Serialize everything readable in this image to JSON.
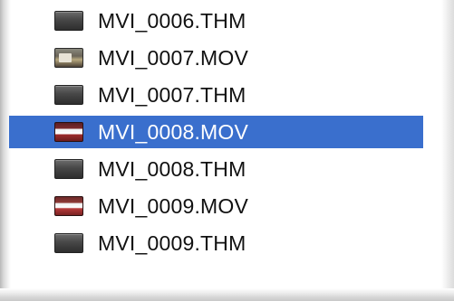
{
  "file_list": {
    "items": [
      {
        "name": "MVI_0006.THM",
        "kind": "thm",
        "selected": false
      },
      {
        "name": "MVI_0007.MOV",
        "kind": "mov-a",
        "selected": false
      },
      {
        "name": "MVI_0007.THM",
        "kind": "thm",
        "selected": false
      },
      {
        "name": "MVI_0008.MOV",
        "kind": "mov-b",
        "selected": true
      },
      {
        "name": "MVI_0008.THM",
        "kind": "thm",
        "selected": false
      },
      {
        "name": "MVI_0009.MOV",
        "kind": "mov-c",
        "selected": false
      },
      {
        "name": "MVI_0009.THM",
        "kind": "thm",
        "selected": false
      }
    ]
  },
  "colors": {
    "selection": "#3a6fcd",
    "text": "#111111",
    "selected_text": "#ffffff"
  }
}
